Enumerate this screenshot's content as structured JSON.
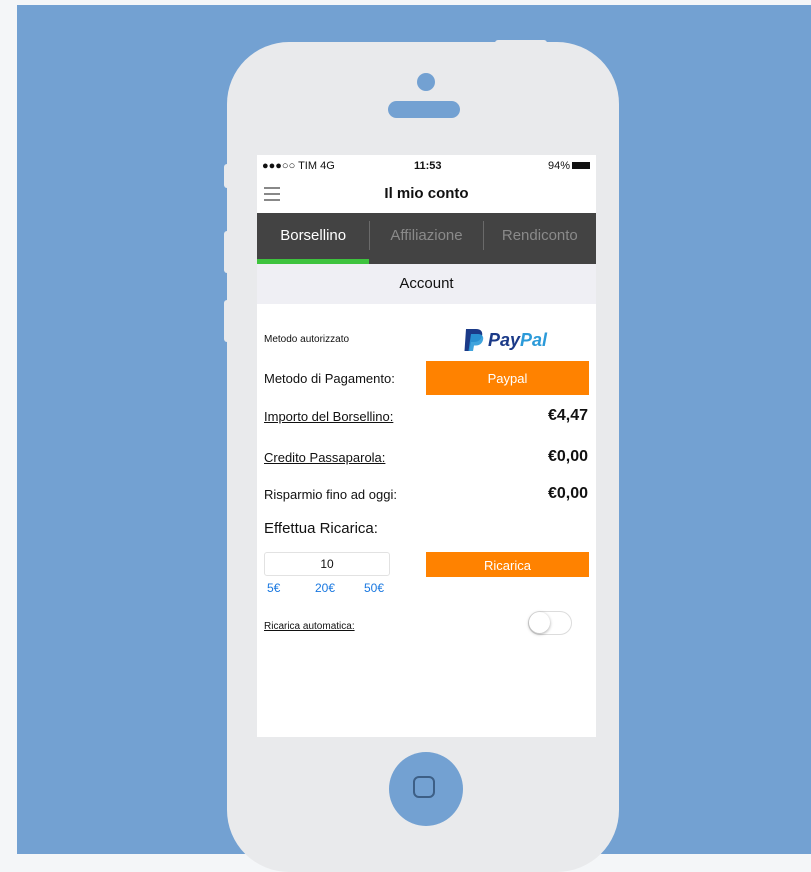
{
  "status_bar": {
    "carrier": "●●●○○ TIM  4G",
    "time": "11:53",
    "battery": "94%"
  },
  "nav": {
    "title": "Il mio conto",
    "menu_icon": "hamburger-icon"
  },
  "tabs": [
    {
      "label": "Borsellino",
      "active": true
    },
    {
      "label": "Affiliazione",
      "active": false
    },
    {
      "label": "Rendiconto",
      "active": false
    }
  ],
  "section_header": "Account",
  "authorized_method": {
    "label": "Metodo autorizzato",
    "logo_word_1": "Pay",
    "logo_word_2": "Pal"
  },
  "payment_method": {
    "label": "Metodo di Pagamento:",
    "button_label": "Paypal"
  },
  "wallet_amount": {
    "label": "Importo del Borsellino:",
    "value": "€4,47"
  },
  "referral_credit": {
    "label": "Credito Passaparola:",
    "value": "€0,00"
  },
  "savings": {
    "label": "Risparmio fino ad oggi:",
    "value": "€0,00"
  },
  "recharge": {
    "title": "Effettua Ricarica:",
    "amount_value": "10",
    "quick_amounts": [
      "5€",
      "20€",
      "50€"
    ],
    "button_label": "Ricarica"
  },
  "auto_recharge": {
    "label": "Ricarica automatica:",
    "enabled": false
  },
  "colors": {
    "background": "#73a1d2",
    "accent_orange": "#ff8200",
    "tab_bar": "#434343",
    "tab_active_indicator": "#3ec33e",
    "link_blue": "#1a78e0"
  }
}
